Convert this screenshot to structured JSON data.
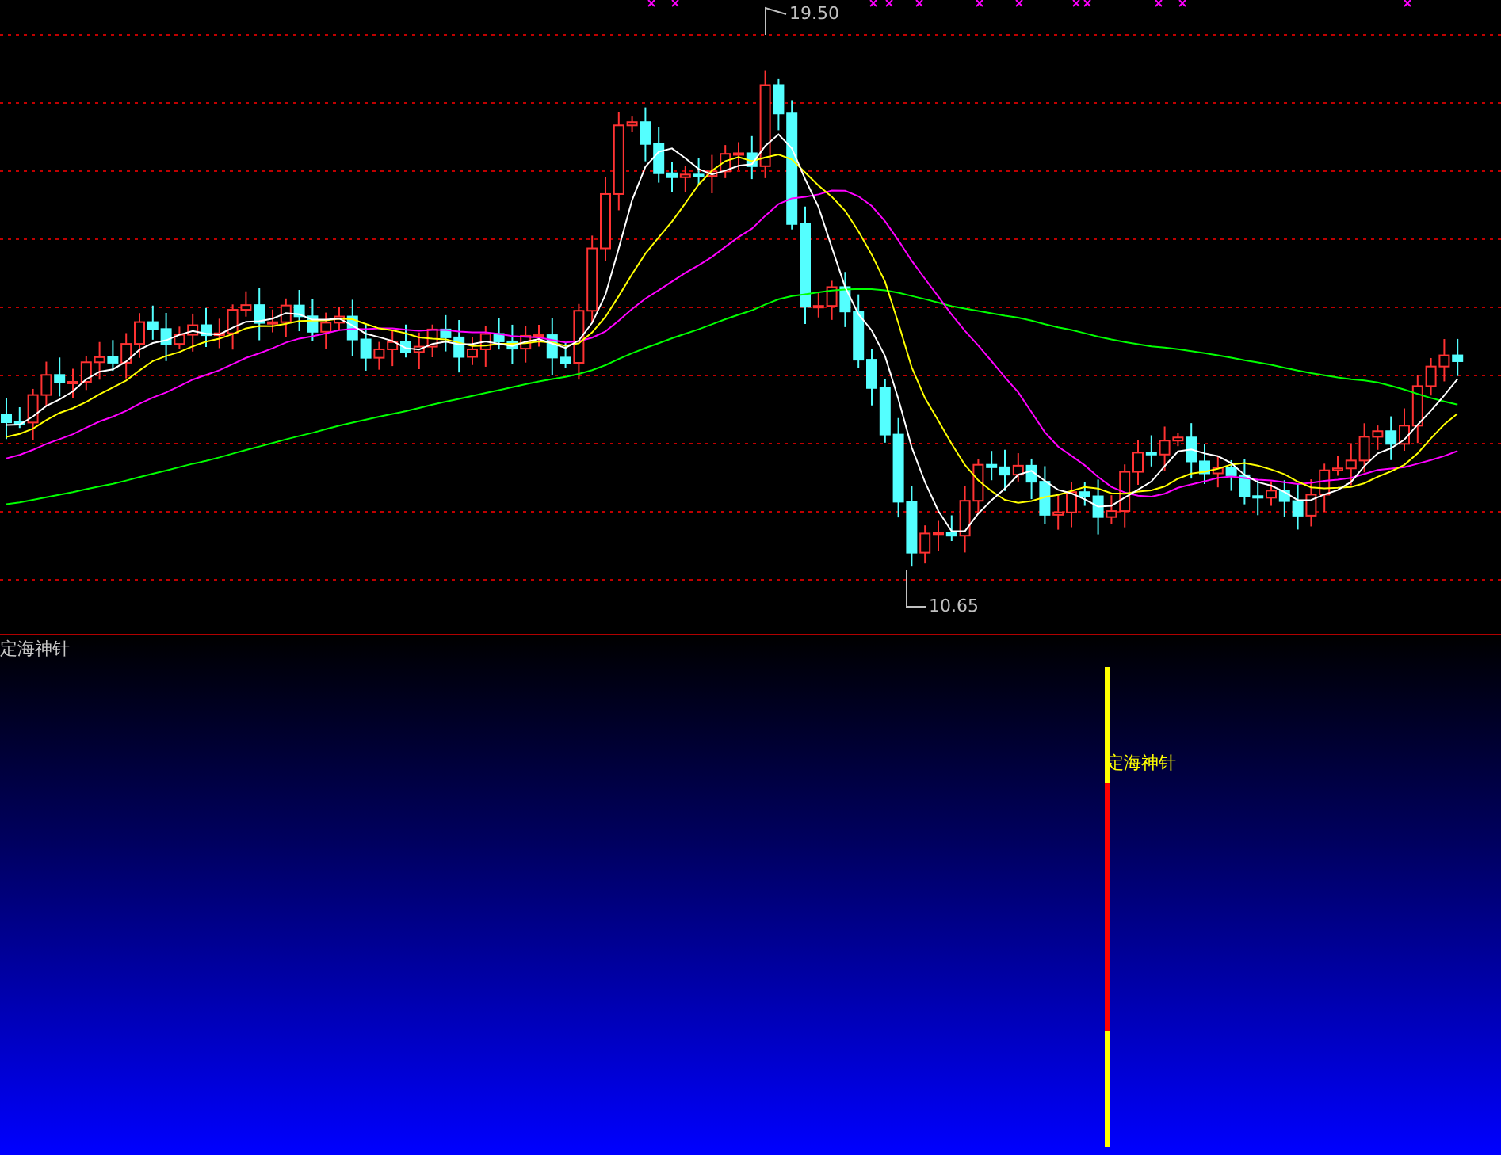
{
  "main_chart": {
    "high_label": "19.50",
    "low_label": "10.65"
  },
  "indicator_panel": {
    "title": "定海神针",
    "signal_label": "定海神针"
  }
}
